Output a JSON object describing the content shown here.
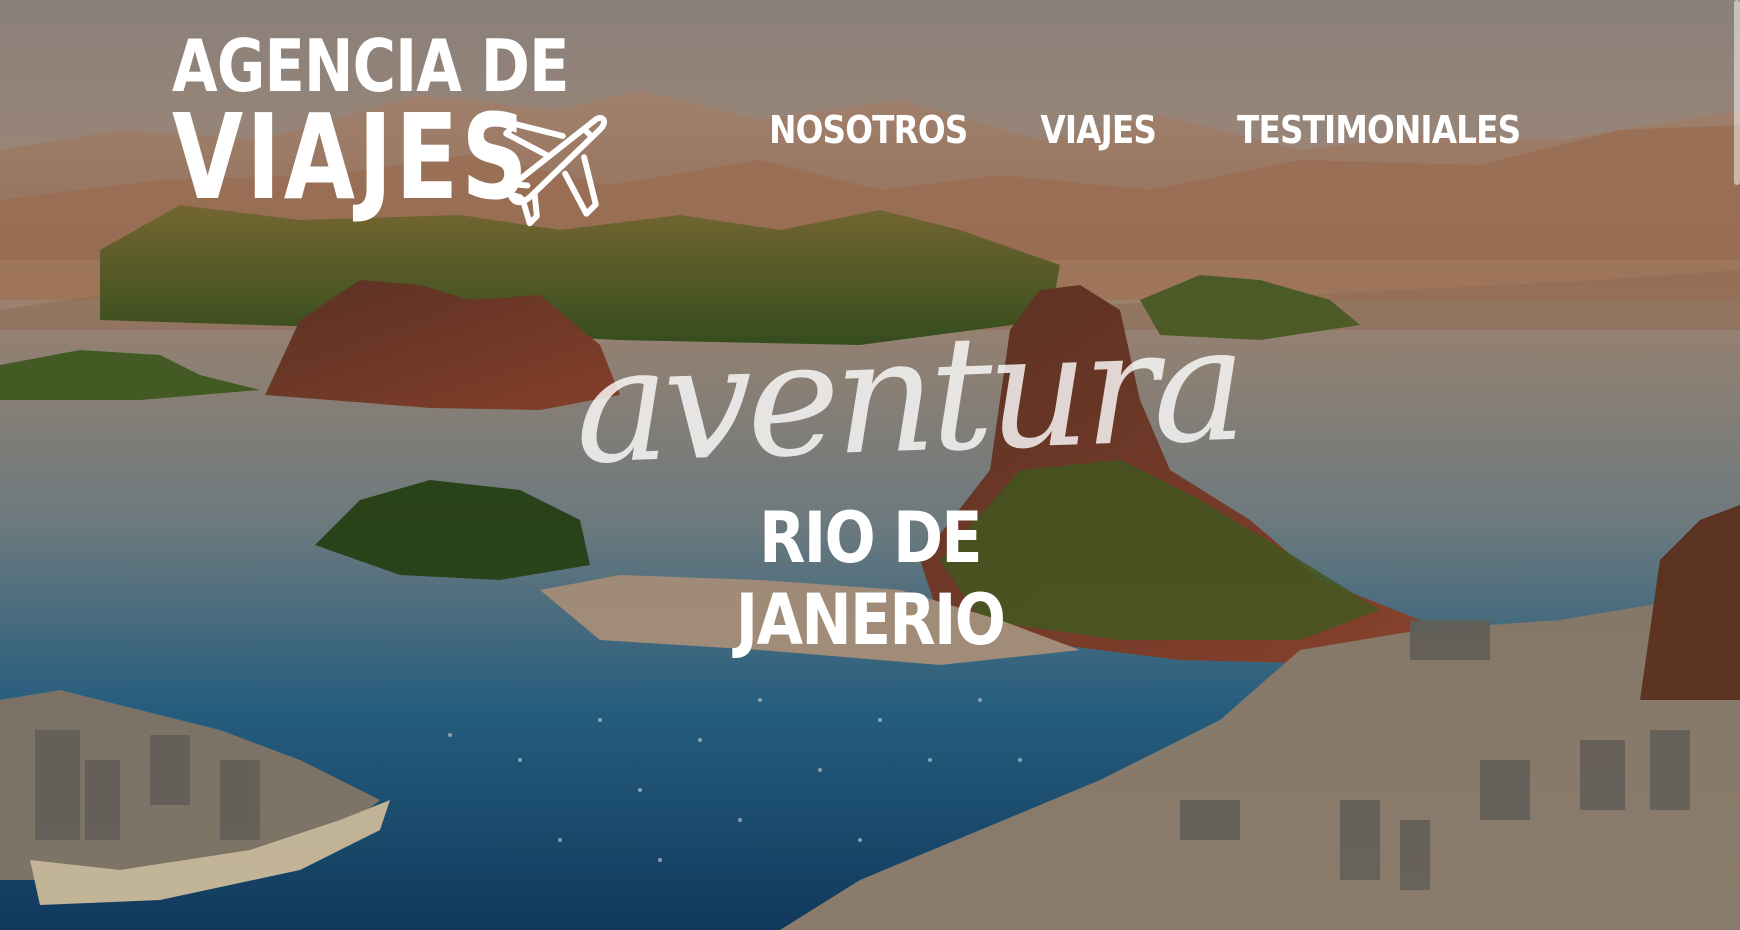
{
  "logo": {
    "line1": "AGENCIA DE",
    "line2": "VIAJES",
    "icon": "airplane-icon"
  },
  "nav": {
    "items": [
      {
        "label": "NOSOTROS"
      },
      {
        "label": "VIAJES"
      },
      {
        "label": "TESTIMONIALES"
      }
    ]
  },
  "hero": {
    "tagline": "aventura",
    "destination": "RIO DE JANERIO"
  },
  "colors": {
    "text": "#ffffff",
    "sky": "#c99a7c",
    "water": "#1b5a80"
  }
}
